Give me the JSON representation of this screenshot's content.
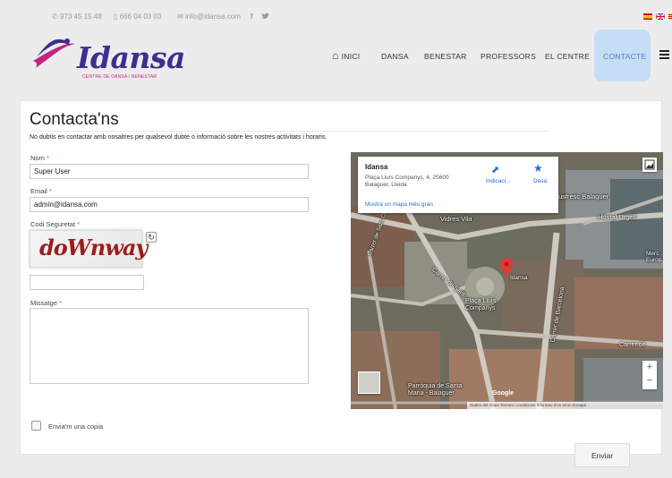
{
  "topbar": {
    "phone1": "973 45 15 48",
    "phone2": "666 04 03 03",
    "email": "info@idansa.com",
    "facebook": "f",
    "twitter": "t"
  },
  "logo": {
    "name": "Idansa",
    "tagline": "CENTRE DE DANSA I BENESTAR"
  },
  "nav": {
    "items": [
      "INICI",
      "DANSA",
      "BENESTAR",
      "PROFESSORS",
      "EL CENTRE",
      "CONTACTE"
    ],
    "active": "CONTACTE"
  },
  "contact": {
    "title": "Contacta'ns",
    "intro": "No dubtis en contactar amb nosaltres per qualsevol dubte o informació sobre les nostres activitats i horaris.",
    "name_label": "Nom",
    "name_value": "Super User",
    "email_label": "Email",
    "email_value": "admin@idansa.com",
    "security_label": "Codi Seguretat",
    "captcha_text": "doWnway",
    "message_label": "Missatge",
    "copy_label": "Envia'm una copia",
    "submit_label": "Enviar",
    "required_marker": "*"
  },
  "map": {
    "place_name": "Idansa",
    "address_line1": "Plaça Lluís Companys, 4, 25600",
    "address_line2": "Balaguer, Lleida",
    "directions_label": "Indicaci...",
    "save_label": "Desa",
    "larger_map_link": "Mostra un mapa més gran",
    "labels": {
      "pin": "Idansa",
      "square": "Plaça Lluís Companys",
      "church": "Parròquia de Santa Maria - Balaguer",
      "vidres": "Vidres Vila",
      "fresc": "usfresc Balaguer",
      "hostal": "Hostal Urgell",
      "mercat": "Merc Europ",
      "carrer_left": "Carrer de Sant",
      "carrer_barcelona": "Carrer de Barcelona",
      "carrer_right": "Carrer de",
      "carrer_avinguda": "Carrer de Sant Crist"
    },
    "footer": "Dades del mapa  Termes i condicions  Informeu d'un error al mapa",
    "zoom_in": "+",
    "zoom_out": "−"
  },
  "colors": {
    "brand": "#3b2f8f",
    "accent": "#c3257f",
    "nav_active_bg": "#c5def6",
    "required": "#d9534f"
  }
}
